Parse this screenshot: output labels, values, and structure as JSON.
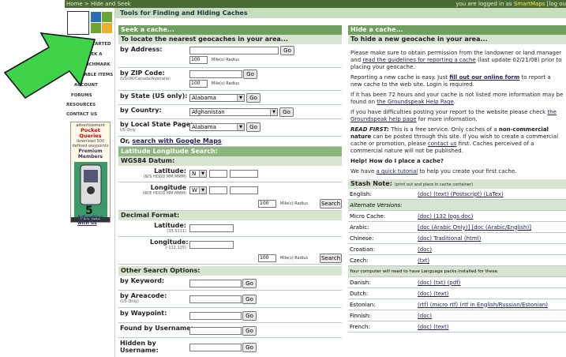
{
  "topbar": {
    "breadcrumb": "Home > Hide and Seek",
    "login_prefix": "you are logged in as ",
    "login_user": "SmartMaps",
    "logout": "[log ou"
  },
  "sidebar": {
    "items": [
      {
        "label": "GETTING STARTED"
      },
      {
        "label": "HIDE & SEEK A CACHE"
      },
      {
        "label": "A BENCHMARK"
      },
      {
        "label": "ACKABLE ITEMS"
      },
      {
        "label": "ACCOUNT"
      },
      {
        "label": "FORUMS"
      },
      {
        "label": "RESOURCES"
      },
      {
        "label": "CONTACT US"
      }
    ],
    "ad": {
      "label": "advertisement",
      "title": "Pocket Queries",
      "line1": "download 500",
      "line2": "defined waypoints",
      "premium": "Premium",
      "members": "Members",
      "click": "Click here",
      "advertise": "Advertise with us"
    }
  },
  "page_title": "Tools for Finding and Hiding Caches",
  "seek": {
    "header": "Seek a cache...",
    "locate_title": "To locate the nearest geocaches in your area...",
    "by_address": "by Address:",
    "go": "Go",
    "radius_value": "100",
    "radius_label": "Mile(s) Radius",
    "by_zip": "by ZIP Code:",
    "zip_sub": "(US/UK/Canada/Australia)",
    "by_state": "by State (US only):",
    "state_value": "Alabama",
    "by_country": "by Country:",
    "country_value": "Afghanistan",
    "by_local_state": "by Local State Page:",
    "local_sub": "US Only",
    "local_value": "Alabama",
    "or_search": "Or, ",
    "google_maps": "search with Google Maps",
    "latlon_header": "Latitude Longitude Search:",
    "wgs_header": "WGS84 Datum:",
    "latitude": "Latitude:",
    "lat_sub": "(N/S HDDD MM.MMM)",
    "lat_dir": "N",
    "longitude": "Longitude",
    "lon_sub": "(W/E HDDD MM.MMM)",
    "lon_dir": "W",
    "search": "Search",
    "decimal_header": "Decimal Format:",
    "dec_lat": "Latitude:",
    "dec_lat_sub": "(33.5111)",
    "dec_lon": "Longitude:",
    "dec_lon_sub": "(-112.125)",
    "other_header": "Other Search Options:",
    "by_keyword": "by Keyword:",
    "by_areacode": "by Areacode:",
    "areacode_sub": "(US Only)",
    "by_waypoint": "by Waypoint:",
    "found_by": "Found by Username:",
    "hidden_by": "Hidden by Username:"
  },
  "hide": {
    "header": "Hide a cache...",
    "sub": "To hide a new geocache in your area...",
    "p1a": "Please make sure to obtain permission from the landowner or land manager and ",
    "p1link": "read the guidelines for reporting a cache",
    "p1b": " (last update 02/21/08) prior to placing your geocache.",
    "p2a": "Reporting a new cache is easy. Just ",
    "p2link": "fill out our online form",
    "p2b": " to report a new cache to the web site. Login is required.",
    "p3a": "If it has been 72 hours and your cache is not listed more information may be found on ",
    "p3link": "the Groundspeak Help Page",
    "p3b": ".",
    "p4a": "If you have difficulties posting your report to the website please check ",
    "p4link": "the Groundspeak help page",
    "p4b": " for more information.",
    "p5a": "READ FIRST:",
    "p5b": " This is a free service. Only caches of a ",
    "p5c": "non-commercial nature",
    "p5d": " can be posted through this site. If you wish to create a commercial cache or promotion, please ",
    "p5link": "contact us",
    "p5e": " first. Caches perceived of a commercial nature will not be published.",
    "help_title": "Help! How do I place a cache?",
    "p6a": "We have ",
    "p6link": "a quick tutorial",
    "p6b": " to help you create your first cache."
  },
  "stash": {
    "header": "Stash Note:",
    "header_sub": "(print out and place in cache container)",
    "rows": [
      {
        "lang": "English:",
        "links": "(doc) (text) (Postscript) (LaTex)"
      },
      {
        "lang": "Alternate Versions:",
        "links": "",
        "italic": true
      },
      {
        "lang": "Micro Cache:",
        "links": "(doc) (132 logs doc)"
      },
      {
        "lang": "Arabic:",
        "links": "[doc (Arabic Only)] [doc (Arabic/English)]"
      },
      {
        "lang": "Chinese:",
        "links": "(doc) Traditional (html)"
      },
      {
        "lang": "Croatian:",
        "links": "(doc)"
      },
      {
        "lang": "Czech:",
        "links": "(txt)"
      },
      {
        "lang": "Your computer will need to have Language packs installed for these.",
        "links": "",
        "note": true
      },
      {
        "lang": "Danish:",
        "links": "(doc) (txt) (pdf)"
      },
      {
        "lang": "Dutch:",
        "links": "(doc) (text)"
      },
      {
        "lang": "Estonian:",
        "links": "(rtf) (micro rtf) (rtf in English/Russian/Estonian)"
      },
      {
        "lang": "Finnish:",
        "links": "(doc)"
      },
      {
        "lang": "French:",
        "links": "(doc) (text)"
      }
    ]
  }
}
